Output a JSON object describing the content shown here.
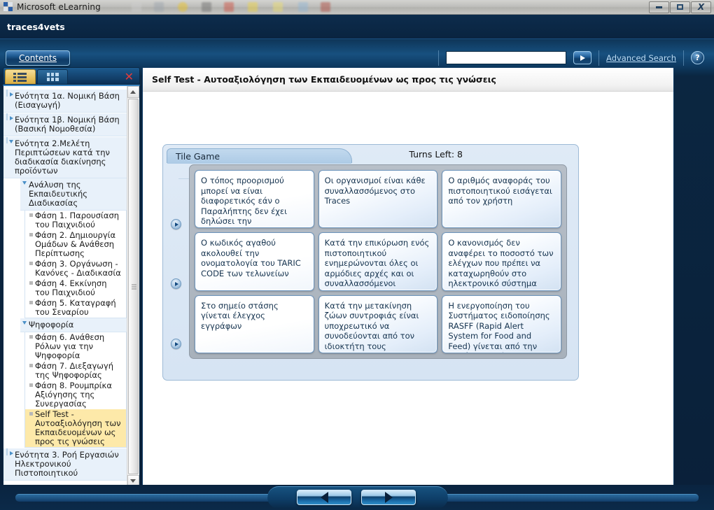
{
  "os": {
    "title": "Microsoft eLearning",
    "app_icon": "app-tiles-icon",
    "window_buttons": [
      {
        "name": "minimize-button",
        "glyph": "minimize-icon"
      },
      {
        "name": "maximize-button",
        "glyph": "maximize-icon"
      },
      {
        "name": "close-button",
        "glyph": "close-icon",
        "label": "X"
      }
    ]
  },
  "brandbar": {
    "brand": "traces4vets"
  },
  "toolbar": {
    "contents_label": "Contents",
    "search_value": "",
    "search_placeholder": "",
    "search_go_icon": "play-arrow-icon",
    "advanced_search_label": "Advanced Search",
    "help_label": "?"
  },
  "navpanel": {
    "tabs": [
      {
        "name": "tab-list-view",
        "icon": "list-view-icon",
        "active": true
      },
      {
        "name": "tab-grid-view",
        "icon": "grid-view-icon",
        "active": false
      }
    ],
    "close_label": "✕",
    "tree": [
      {
        "level": 1,
        "marker": "collapsed",
        "label": "Ενότητα 1α. Νομική Βάση (Εισαγωγή)"
      },
      {
        "level": 1,
        "marker": "collapsed",
        "label": "Ενότητα 1β. Νομική Βάση (Βασική Νομοθεσία)"
      },
      {
        "level": 1,
        "marker": "expanded",
        "label": "Ενότητα 2.Μελέτη Περιπτώσεων κατά την διαδικασία διακίνησης προϊόντων"
      },
      {
        "level": 2,
        "marker": "expanded",
        "label": "Ανάλυση της Εκπαιδευτικής Διαδικασίας"
      },
      {
        "level": 3,
        "marker": "leaf",
        "label": "Φάση 1. Παρουσίαση του Παιχνιδιού"
      },
      {
        "level": 3,
        "marker": "leaf",
        "label": "Φάση 2. Δημιουργία Ομάδων & Ανάθεση Περίπτωσης"
      },
      {
        "level": 3,
        "marker": "leaf",
        "label": "Φάση 3. Οργάνωση - Κανόνες - Διαδικασία"
      },
      {
        "level": 3,
        "marker": "leaf",
        "label": "Φάση 4. Εκκίνηση του Παιχνιδιού"
      },
      {
        "level": 3,
        "marker": "leaf",
        "label": "Φάση 5. Καταγραφή του Σεναρίου"
      },
      {
        "level": 2,
        "marker": "expanded",
        "label": "Ψηφοφορία"
      },
      {
        "level": 3,
        "marker": "leaf",
        "label": "Φάση 6. Ανάθεση Ρόλων για την Ψηφοφορία"
      },
      {
        "level": 3,
        "marker": "leaf",
        "label": "Φάση 7. Διεξαγωγή της Ψηφοφορίας"
      },
      {
        "level": 3,
        "marker": "leaf",
        "label": "Φάση 8. Ρουμπρίκα Αξιόγησης της Συνεργασίας"
      },
      {
        "level": 3,
        "marker": "leaf",
        "highlight": true,
        "label": "Self Test - Αυτοαξιολόγηση των Εκπαιδευομένων ως προς τις γνώσεις"
      },
      {
        "level": 1,
        "marker": "collapsed",
        "label": "Ενότητα 3. Ροή Εργασιών Ηλεκτρονικού Πιστοποιητικού"
      }
    ],
    "scrollbar": {
      "up_icon": "scroll-up-icon",
      "down_icon": "scroll-down-icon",
      "grip_icon": "scroll-grip-icon"
    }
  },
  "content": {
    "page_title": "Self Test - Αυτοαξιολόγηση των Εκπαιδευομένων ως προς τις γνώσεις",
    "game": {
      "panel_label": "Tile Game",
      "turns_label": "Turns Left:",
      "turns_value": "8",
      "column_buttons": [
        {
          "name": "column-play-button-1",
          "icon": "caret-down-icon"
        },
        {
          "name": "column-play-button-2",
          "icon": "caret-down-icon"
        },
        {
          "name": "column-play-button-3",
          "icon": "caret-down-icon"
        }
      ],
      "row_buttons": [
        {
          "name": "row-play-button-1",
          "icon": "caret-right-icon"
        },
        {
          "name": "row-play-button-2",
          "icon": "caret-right-icon"
        },
        {
          "name": "row-play-button-3",
          "icon": "caret-right-icon"
        }
      ],
      "tiles": [
        {
          "id": 1,
          "style": "plain",
          "text": "Ο τόπος προορισμού μπορεί να είναι διαφορετικός εάν ο Παραλήπτης δεν έχει δηλώσει την Εγκατάστασή του."
        },
        {
          "id": 2,
          "style": "gradient",
          "text": "Οι οργανισμοί είναι κάθε συναλλασσόμενος στο Traces"
        },
        {
          "id": 3,
          "style": "gradient",
          "text": "Ο αριθμός αναφοράς του πιστοποιητικού εισάγεται από τον χρήστη"
        },
        {
          "id": 4,
          "style": "plain",
          "text": "Ο κωδικός αγαθού ακολουθεί την ονοματολογία του TARIC CODE των τελωνείων"
        },
        {
          "id": 5,
          "style": "gradient",
          "text": "Κατά την επικύρωση ενός πιστοποιητικού ενημερώνονται όλες οι αρμόδιες αρχές και οι συναλλασσόμενοι"
        },
        {
          "id": 6,
          "style": "gradient",
          "text": "Ο κανονισμός δεν αναφέρει το ποσοστό των ελέγχων που πρέπει να καταχωρηθούν στο ηλεκτρονικό σύστημα"
        },
        {
          "id": 7,
          "style": "plain",
          "text": "Στο σημείο στάσης γίνεται έλεγχος εγγράφων"
        },
        {
          "id": 8,
          "style": "gradient",
          "text": "Κατά την μετακίνηση ζώων συντροφιάς είναι υποχρεωτικό να συνοδεύονται από τον ιδιοκτήτη τους"
        },
        {
          "id": 9,
          "style": "gradient",
          "text": "Η ενεργοποίηση του Συστήματος ειδοποίησης RASFF (Rapid Alert System for Food and Feed) γίνεται από την αρμόδια αρχή που"
        }
      ]
    }
  },
  "bottomnav": {
    "prev_icon": "arrow-left-icon",
    "next_icon": "arrow-right-icon"
  }
}
